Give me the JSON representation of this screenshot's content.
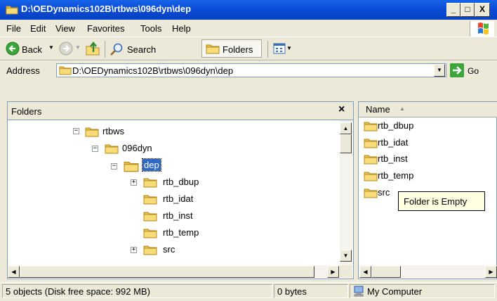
{
  "window": {
    "title": "D:\\OEDynamics102B\\rtbws\\096dyn\\dep",
    "minimize": "_",
    "maximize": "□",
    "close": "X"
  },
  "menu": {
    "items": [
      "File",
      "Edit",
      "View",
      "Favorites",
      "Tools",
      "Help"
    ]
  },
  "toolbar": {
    "back": "Back",
    "search": "Search",
    "folders": "Folders"
  },
  "address": {
    "label": "Address",
    "value": "D:\\OEDynamics102B\\rtbws\\096dyn\\dep",
    "go": "Go"
  },
  "folders_pane": {
    "title": "Folders",
    "close": "×",
    "tree": [
      {
        "label": "rtbws",
        "expander": "−",
        "selected": false
      },
      {
        "label": "096dyn",
        "expander": "−",
        "selected": false
      },
      {
        "label": "dep",
        "expander": "−",
        "selected": true
      },
      {
        "label": "rtb_dbup",
        "expander": "+",
        "selected": false
      },
      {
        "label": "rtb_idat",
        "expander": "",
        "selected": false
      },
      {
        "label": "rtb_inst",
        "expander": "",
        "selected": false
      },
      {
        "label": "rtb_temp",
        "expander": "",
        "selected": false
      },
      {
        "label": "src",
        "expander": "+",
        "selected": false
      }
    ]
  },
  "list_pane": {
    "column_name": "Name",
    "sort_indicator": "▲",
    "items": [
      "rtb_dbup",
      "rtb_idat",
      "rtb_inst",
      "rtb_temp",
      "src"
    ],
    "tooltip": "Folder is Empty"
  },
  "status": {
    "objects": "5 objects (Disk free space: 992 MB)",
    "size": "0 bytes",
    "location": "My Computer"
  },
  "colors": {
    "title_bar": "#0A4BD6",
    "chrome": "#ECE9D8",
    "selection": "#316AC5",
    "folder": "#F5D96B"
  }
}
